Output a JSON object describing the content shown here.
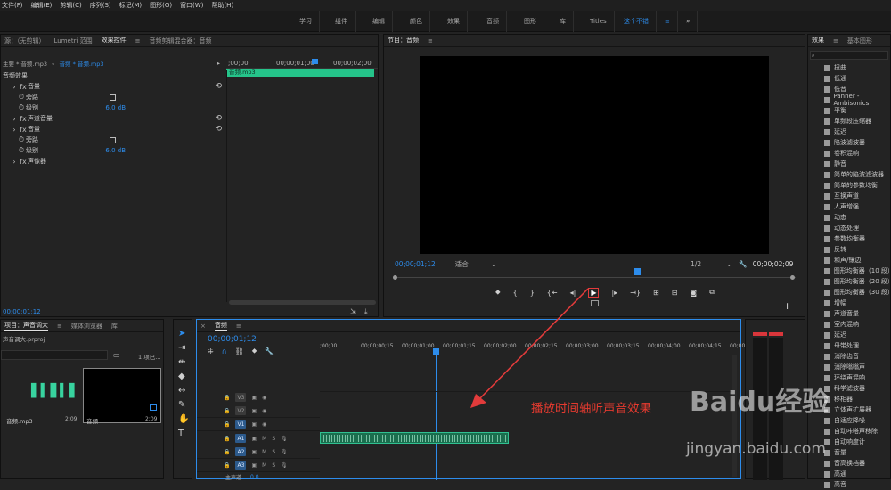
{
  "menu": [
    "文件(F)",
    "编辑(E)",
    "剪辑(C)",
    "序列(S)",
    "标记(M)",
    "图形(G)",
    "窗口(W)",
    "帮助(H)"
  ],
  "workspaces": [
    "学习",
    "组件",
    "编辑",
    "颜色",
    "效果",
    "音频",
    "图形",
    "库",
    "Titles",
    "这个不错",
    "≡",
    "»"
  ],
  "source_panel": {
    "tabs": [
      "源：（无剪辑）",
      "Lumetri 范围",
      "效果控件",
      "≡",
      "音频剪辑混合器：音频"
    ],
    "breadcrumb_master": "主要 * 音频.mp3",
    "breadcrumb_clip": "音频 * 音频.mp3",
    "ruler": [
      ";00;00",
      "00;00;01;00",
      "00;00;02;00"
    ],
    "clip_name": "音频.mp3",
    "rows": [
      {
        "label": "音频效果",
        "indent": 0
      },
      {
        "label": "音量",
        "indent": 1,
        "fx": true
      },
      {
        "label": "旁路",
        "indent": 2,
        "check": true
      },
      {
        "label": "级别",
        "indent": 2,
        "value": "6.0 dB"
      },
      {
        "label": "声道音量",
        "indent": 1,
        "fx": true
      },
      {
        "label": "音量",
        "indent": 1,
        "fx": true
      },
      {
        "label": "旁路",
        "indent": 2,
        "check": true
      },
      {
        "label": "级别",
        "indent": 2,
        "value": "6.0 dB"
      },
      {
        "label": "声像器",
        "indent": 1,
        "fx": true
      }
    ],
    "timecode": "00;00;01;12"
  },
  "program": {
    "title": "节目：音频",
    "timecode": "00;00;01;12",
    "fit": "适合",
    "quality": "1/2",
    "duration": "00;00;02;09"
  },
  "effects": {
    "tabs": [
      "效果",
      "≡",
      "基本图形"
    ],
    "items": [
      "扭曲",
      "低通",
      "低音",
      "Panner - Ambisonics",
      "平衡",
      "单频段压缩器",
      "延迟",
      "陷波滤波器",
      "卷积混响",
      "静音",
      "简单的陷波滤波器",
      "简单的参数均衡",
      "互换声道",
      "人声增强",
      "动态",
      "动态处理",
      "参数均衡器",
      "反转",
      "和声/镶边",
      "图形均衡器（10 段）",
      "图形均衡器（20 段）",
      "图形均衡器（30 段）",
      "增幅",
      "声道音量",
      "室内混响",
      "延迟",
      "母带处理",
      "消除齿音",
      "消除嗡嗡声",
      "环绕声混响",
      "科学滤波器",
      "移相器",
      "立体声扩展器",
      "自适应降噪",
      "自动咔嗒声移除",
      "自动响度计",
      "音量",
      "音高换档器",
      "高通",
      "高音"
    ]
  },
  "project": {
    "tabs": [
      "项目：声音调大",
      "≡",
      "媒体浏览器",
      "库"
    ],
    "file": "声音调大.prproj",
    "count": "1 项已...",
    "items": [
      {
        "name": "音频.mp3",
        "dur": "2;09"
      },
      {
        "name": "音频",
        "dur": "2;09"
      }
    ]
  },
  "timeline": {
    "tab": "音频",
    "timecode": "00;00;01;12",
    "ruler": [
      ";00;00",
      "00;00;00;15",
      "00;00;01;00",
      "00;00;01;15",
      "00;00;02;00",
      "00;00;02;15",
      "00;00;03;00",
      "00;00;03;15",
      "00;00;04;00",
      "00;00;04;15",
      "00;00"
    ],
    "video_tracks": [
      "V3",
      "V2",
      "V1"
    ],
    "audio_tracks": [
      "A1",
      "A2",
      "A3"
    ],
    "master": "主声道",
    "master_val": "0.0"
  },
  "annotation": "播放时间轴听声音效果",
  "watermark": {
    "logo": "Baidu经验",
    "url": "jingyan.baidu.com"
  }
}
